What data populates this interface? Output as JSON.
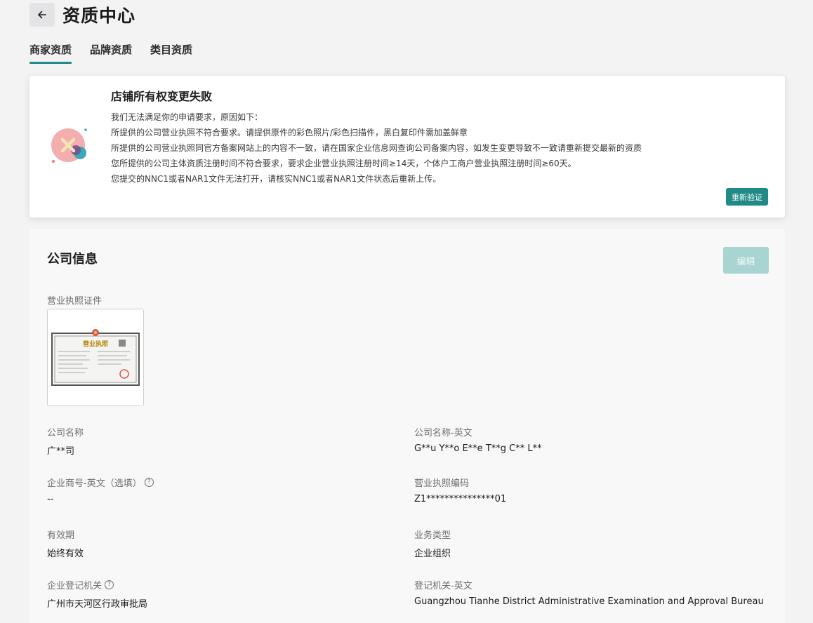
{
  "header": {
    "title": "资质中心"
  },
  "tabs": [
    {
      "label": "商家资质",
      "active": true
    },
    {
      "label": "品牌资质",
      "active": false
    },
    {
      "label": "类目资质",
      "active": false
    }
  ],
  "alert": {
    "title": "店铺所有权变更失败",
    "lines": [
      "我们无法满足你的申请要求，原因如下：",
      "所提供的公司营业执照不符合要求。请提供原件的彩色照片/彩色扫描件，黑白复印件需加盖鲜章",
      "所提供的公司营业执照同官方备案网站上的内容不一致，请在国家企业信息网查询公司备案内容，如发生变更导致不一致请重新提交最新的资质",
      "您所提供的公司主体资质注册时间不符合要求，要求企业营业执照注册时间≥14天，个体户工商户营业执照注册时间≥60天。",
      "您提交的NNC1或者NAR1文件无法打开，请核实NNC1或者NAR1文件状态后重新上传。"
    ],
    "button_label": "重新验证"
  },
  "company": {
    "title": "公司信息",
    "edit_label": "编辑",
    "license_label": "营业执照证件",
    "license_image_text": "营业执照",
    "fields": {
      "name": {
        "label": "公司名称",
        "value": "广**司"
      },
      "name_en": {
        "label": "公司名称-英文",
        "value": "G**u Y**o E**e T**g C** L**"
      },
      "trade_name_en": {
        "label": "企业商号-英文（选填）",
        "value": "--"
      },
      "license_no": {
        "label": "营业执照编码",
        "value": "Z1***************01"
      },
      "validity": {
        "label": "有效期",
        "value": "始终有效"
      },
      "business_type": {
        "label": "业务类型",
        "value": "企业组织"
      },
      "registry": {
        "label": "企业登记机关",
        "value": "广州市天河区行政审批局"
      },
      "registry_en": {
        "label": "登记机关-英文",
        "value": "Guangzhou Tianhe District Administrative Examination and Approval Bureau"
      }
    }
  },
  "colors": {
    "accent": "#1f8a86",
    "accent_disabled": "#a8d4d2",
    "error": "#ef7a7f"
  }
}
